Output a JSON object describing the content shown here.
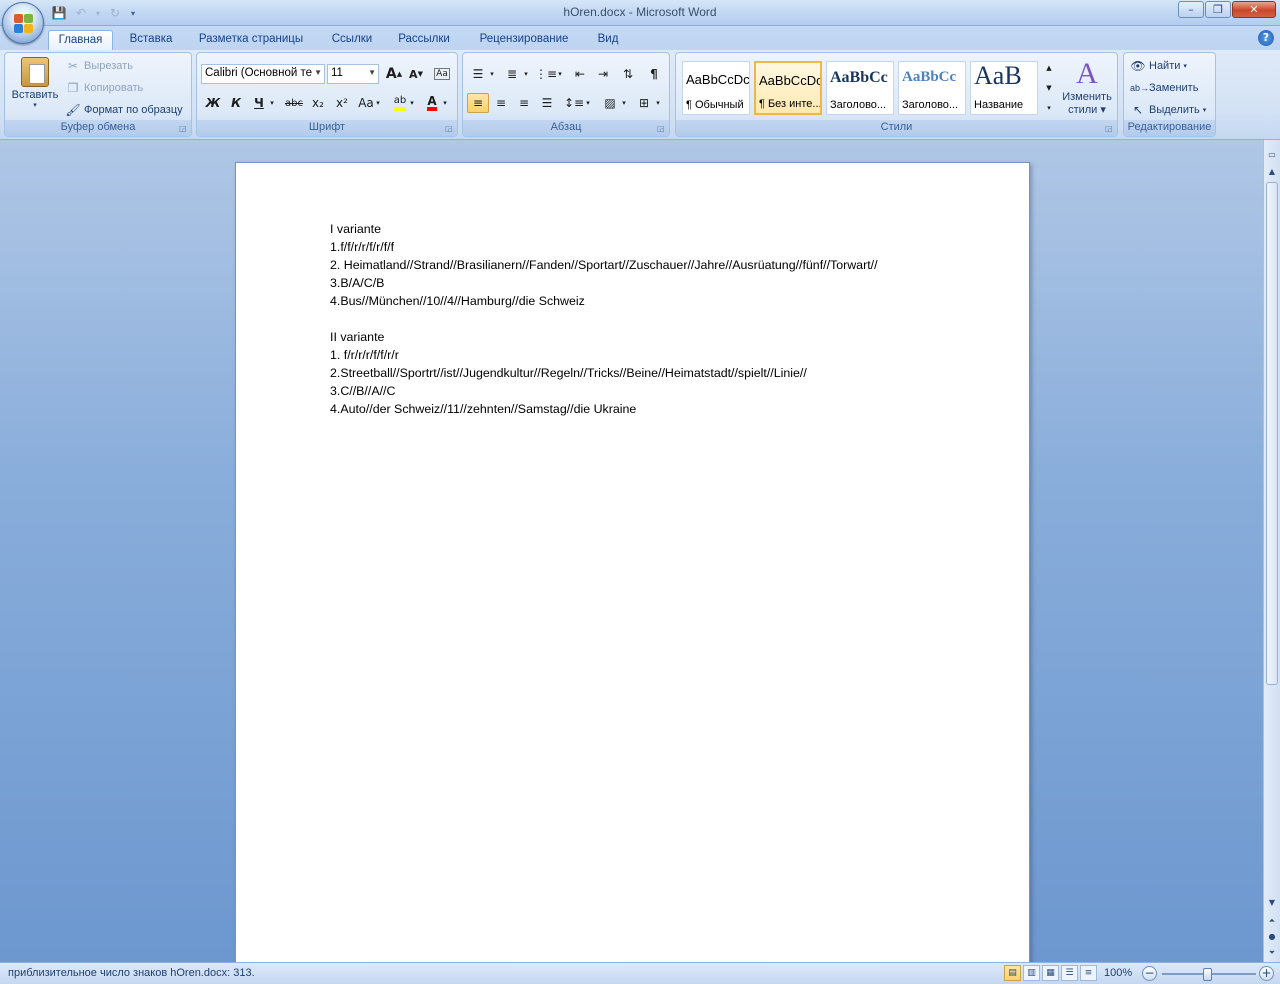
{
  "window": {
    "title": "hOren.docx - Microsoft Word"
  },
  "tabs": [
    "Главная",
    "Вставка",
    "Разметка страницы",
    "Ссылки",
    "Рассылки",
    "Рецензирование",
    "Вид"
  ],
  "clipboard": {
    "paste": "Вставить",
    "cut": "Вырезать",
    "copy": "Копировать",
    "format_painter": "Формат по образцу",
    "label": "Буфер обмена"
  },
  "font": {
    "name": "Calibri (Основной те",
    "size": "11",
    "label": "Шрифт",
    "bold": "Ж",
    "italic": "К",
    "underline": "Ч",
    "strike": "abc",
    "sub": "x₂",
    "sup": "x²",
    "case": "Aa",
    "grow": "A",
    "shrink": "A"
  },
  "paragraph": {
    "label": "Абзац",
    "pilcrow": "¶"
  },
  "styles": {
    "label": "Стили",
    "items": [
      {
        "sample": "AaBbCcDc",
        "name": "¶ Обычный"
      },
      {
        "sample": "AaBbCcDc",
        "name": "¶ Без инте..."
      },
      {
        "sample": "AaBbCc",
        "name": "Заголово..."
      },
      {
        "sample": "AaBbCc",
        "name": "Заголово..."
      },
      {
        "sample": "AaB",
        "name": "Название"
      }
    ],
    "change_styles_1": "Изменить",
    "change_styles_2": "стили"
  },
  "editing": {
    "label": "Редактирование",
    "find": "Найти",
    "replace": "Заменить",
    "select": "Выделить"
  },
  "document": {
    "lines": [
      "I variante",
      "1.f/f/r/r/f/r/f/f",
      "2. Heimatland//Strand//Brasilianern//Fanden//Sportart//Zuschauer//Jahre//Ausrüatung//fünf//Torwart//",
      "3.B/A/C/B",
      "4.Bus//München//10//4//Hamburg//die Schweiz",
      "",
      "II variante",
      "1. f/r/r/r/f/f/r/r",
      "2.Streetball//Sportrt//ist//Jugendkultur//Regeln//Tricks//Beine//Heimatstadt//spielt//Linie//",
      "3.C//B//A//C",
      "4.Auto//der Schweiz//11//zehnten//Samstag//die Ukraine"
    ]
  },
  "status": {
    "text": "приблизительное число знаков hOren.docx: 313.",
    "zoom": "100%"
  },
  "colors": {
    "accent": "#15428b",
    "highlight": "#ffff00",
    "font_color": "#ff0000"
  }
}
